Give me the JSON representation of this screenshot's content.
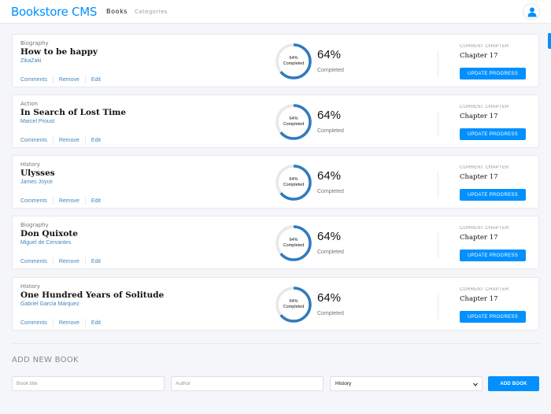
{
  "header": {
    "logo": "Bookstore CMS",
    "nav": [
      "Books",
      "Categories"
    ]
  },
  "books": [
    {
      "genre": "Biography",
      "title": "How to be happy",
      "author": "ZikaZaki",
      "progress": 64,
      "progress_text": "64%",
      "ring_label": "64%",
      "ring_caption": "Completed",
      "completed_label": "Completed",
      "current_chapter_label": "CURRENT CHAPTER",
      "chapter": "Chapter 17",
      "update_label": "UPDATE PROGRESS",
      "actions": [
        "Comments",
        "Remove",
        "Edit"
      ]
    },
    {
      "genre": "Action",
      "title": "In Search of Lost Time",
      "author": "Marcel Proust",
      "progress": 64,
      "progress_text": "64%",
      "ring_label": "64%",
      "ring_caption": "Completed",
      "completed_label": "Completed",
      "current_chapter_label": "CURRENT CHAPTER",
      "chapter": "Chapter 17",
      "update_label": "UPDATE PROGRESS",
      "actions": [
        "Comments",
        "Remove",
        "Edit"
      ]
    },
    {
      "genre": "History",
      "title": "Ulysses",
      "author": "James Joyce",
      "progress": 64,
      "progress_text": "64%",
      "ring_label": "64%",
      "ring_caption": "Completed",
      "completed_label": "Completed",
      "current_chapter_label": "CURRENT CHAPTER",
      "chapter": "Chapter 17",
      "update_label": "UPDATE PROGRESS",
      "actions": [
        "Comments",
        "Remove",
        "Edit"
      ]
    },
    {
      "genre": "Biography",
      "title": "Don Quixote",
      "author": "Miguel de Cervantes",
      "progress": 64,
      "progress_text": "64%",
      "ring_label": "64%",
      "ring_caption": "Completed",
      "completed_label": "Completed",
      "current_chapter_label": "CURRENT CHAPTER",
      "chapter": "Chapter 17",
      "update_label": "UPDATE PROGRESS",
      "actions": [
        "Comments",
        "Remove",
        "Edit"
      ]
    },
    {
      "genre": "History",
      "title": "One Hundred Years of Solitude",
      "author": "Gabriel García Márquez",
      "progress": 64,
      "progress_text": "64%",
      "ring_label": "64%",
      "ring_caption": "Completed",
      "completed_label": "Completed",
      "current_chapter_label": "CURRENT CHAPTER",
      "chapter": "Chapter 17",
      "update_label": "UPDATE PROGRESS",
      "actions": [
        "Comments",
        "Remove",
        "Edit"
      ]
    }
  ],
  "add_book": {
    "heading": "ADD NEW BOOK",
    "title_placeholder": "Book title",
    "author_placeholder": "Author",
    "category_selected": "History",
    "submit_label": "ADD BOOK"
  },
  "colors": {
    "accent": "#0290ff",
    "link": "#4386bf",
    "ring_track": "#e8e8e8",
    "ring_fill": "#307bbe",
    "background": "#f5f6fa"
  },
  "icons": {
    "user": "user-icon",
    "dropdown": "chevron-down-icon"
  }
}
